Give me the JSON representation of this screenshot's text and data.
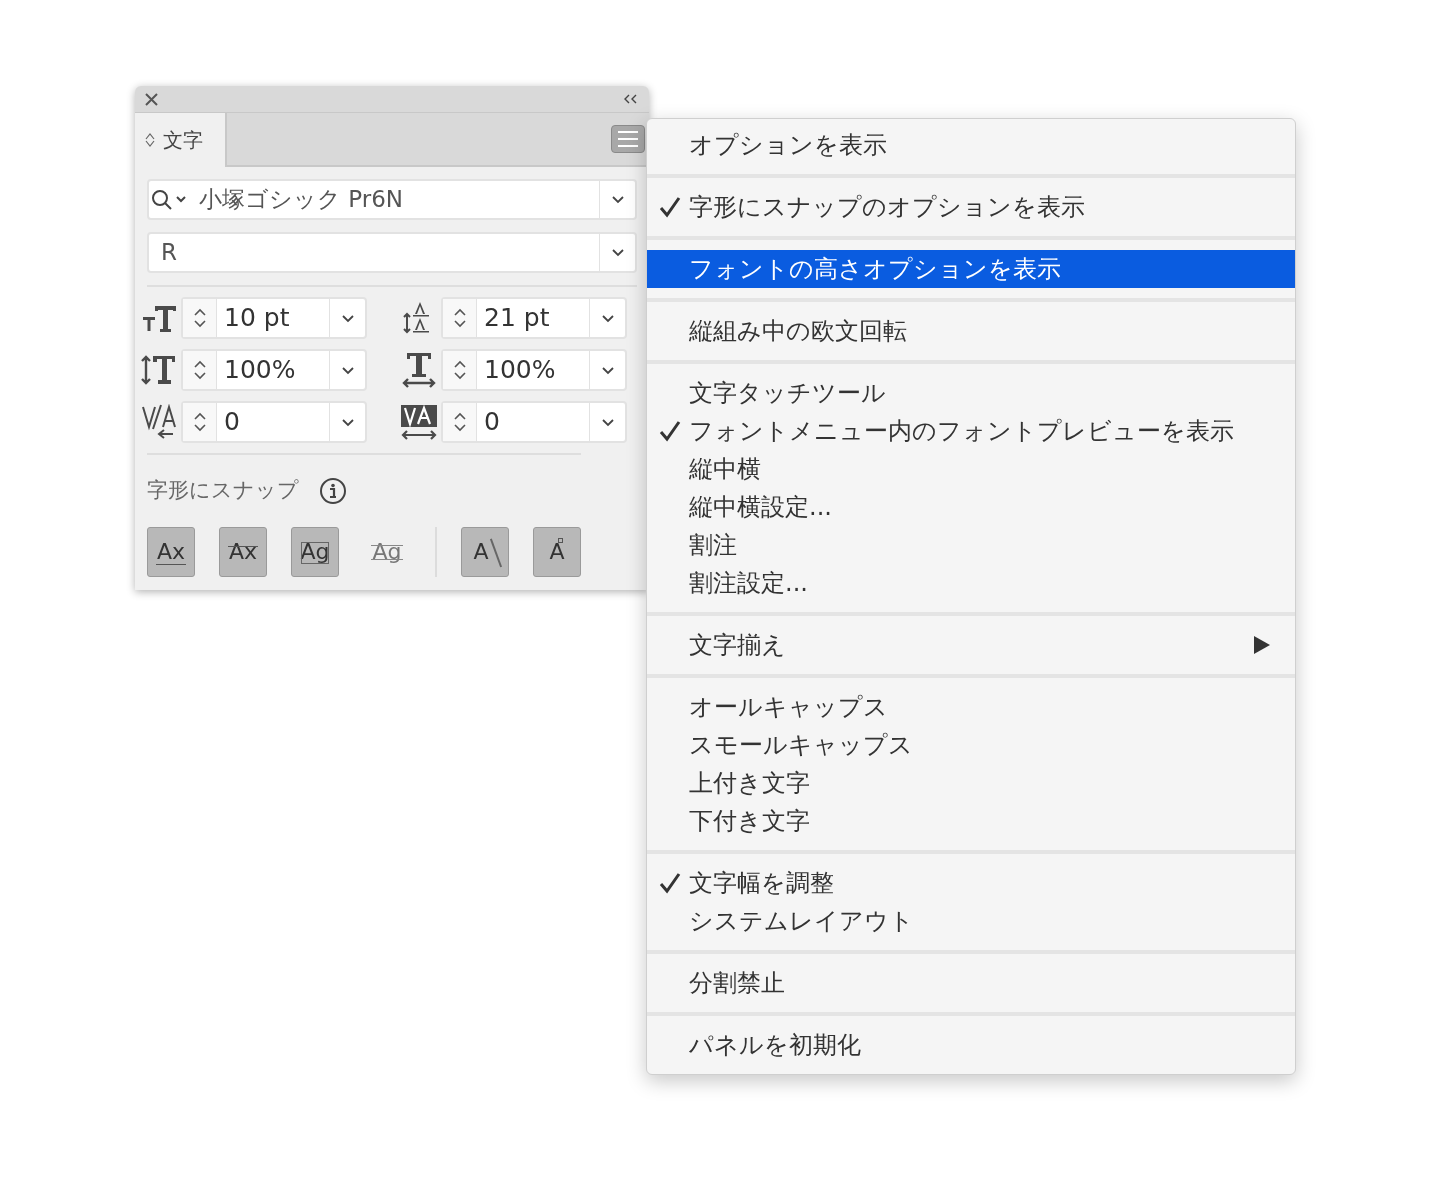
{
  "panel": {
    "tab": {
      "label": "文字",
      "selected": true
    },
    "font_family": "小塚ゴシック Pr6N",
    "font_style": "R",
    "fields": [
      {
        "kind": "font-size",
        "value": "10 pt"
      },
      {
        "kind": "leading",
        "value": "21 pt"
      },
      {
        "kind": "vertical-scale",
        "value": "100%"
      },
      {
        "kind": "horizontal-scale",
        "value": "100%"
      },
      {
        "kind": "kerning",
        "value": "0"
      },
      {
        "kind": "tracking",
        "value": "0"
      }
    ],
    "snap_label": "字形にスナップ",
    "snap_buttons": [
      {
        "label": "Ax",
        "kind": "baseline",
        "on": true
      },
      {
        "label": "Ax",
        "kind": "x-height",
        "on": true
      },
      {
        "label": "Ag",
        "kind": "bounds",
        "on": true
      },
      {
        "label": "Ag",
        "kind": "guide",
        "on": false
      },
      {
        "label": "A",
        "kind": "angle",
        "on": true
      },
      {
        "label": "A",
        "kind": "anchor",
        "on": true
      }
    ]
  },
  "menu": {
    "groups": [
      {
        "items": [
          {
            "label": "オプションを表示",
            "checked": false,
            "selected": false
          }
        ]
      },
      {
        "items": [
          {
            "label": "字形にスナップのオプションを表示",
            "checked": true,
            "selected": false
          }
        ]
      },
      {
        "items": [
          {
            "label": "フォントの高さオプションを表示",
            "checked": false,
            "selected": true
          }
        ]
      },
      {
        "items": [
          {
            "label": "縦組み中の欧文回転",
            "checked": false,
            "selected": false
          }
        ]
      },
      {
        "items": [
          {
            "label": "文字タッチツール",
            "checked": false,
            "selected": false
          },
          {
            "label": "フォントメニュー内のフォントプレビューを表示",
            "checked": true,
            "selected": false
          },
          {
            "label": "縦中横",
            "checked": false,
            "selected": false
          },
          {
            "label": "縦中横設定...",
            "checked": false,
            "selected": false
          },
          {
            "label": "割注",
            "checked": false,
            "selected": false
          },
          {
            "label": "割注設定...",
            "checked": false,
            "selected": false
          }
        ]
      },
      {
        "items": [
          {
            "label": "文字揃え",
            "checked": false,
            "selected": false,
            "submenu": true
          }
        ]
      },
      {
        "items": [
          {
            "label": "オールキャップス",
            "checked": false,
            "selected": false
          },
          {
            "label": "スモールキャップス",
            "checked": false,
            "selected": false
          },
          {
            "label": "上付き文字",
            "checked": false,
            "selected": false
          },
          {
            "label": "下付き文字",
            "checked": false,
            "selected": false
          }
        ]
      },
      {
        "items": [
          {
            "label": "文字幅を調整",
            "checked": true,
            "selected": false
          },
          {
            "label": "システムレイアウト",
            "checked": false,
            "selected": false
          }
        ]
      },
      {
        "items": [
          {
            "label": "分割禁止",
            "checked": false,
            "selected": false
          }
        ]
      },
      {
        "items": [
          {
            "label": "パネルを初期化",
            "checked": false,
            "selected": false
          }
        ]
      }
    ]
  }
}
